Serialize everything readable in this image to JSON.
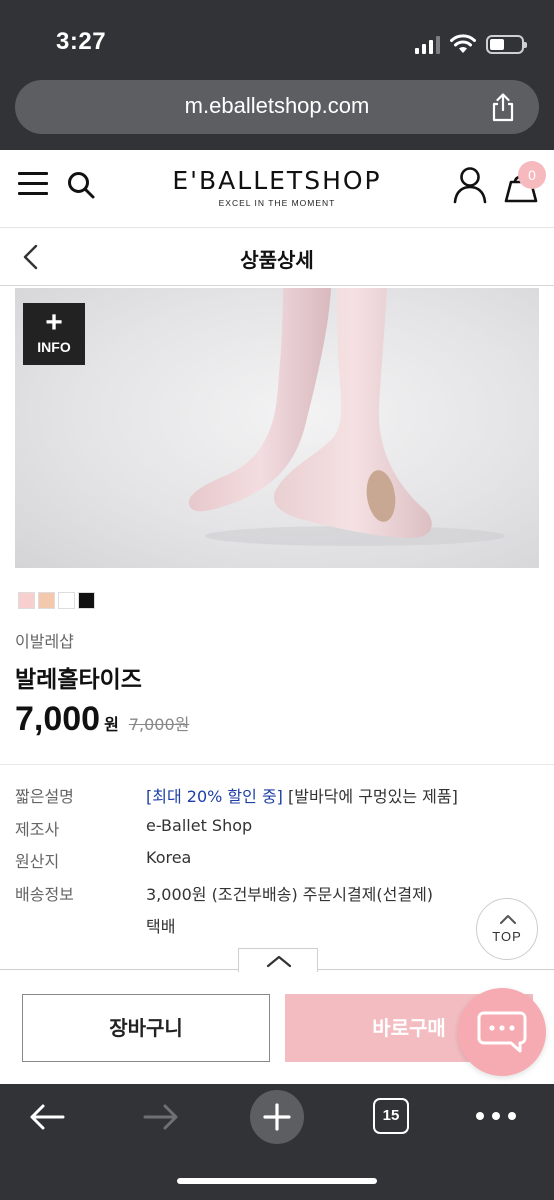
{
  "status_bar": {
    "time": "3:27"
  },
  "browser": {
    "url": "m.eballetshop.com",
    "tab_count": "15"
  },
  "site": {
    "logo": "E'BALLETSHOP",
    "tagline": "EXCEL IN THE MOMENT",
    "cart_count": "0"
  },
  "page": {
    "title": "상품상세"
  },
  "product": {
    "info_badge_plus": "+",
    "info_badge_text": "INFO",
    "swatch_colors": [
      "#f7cfcf",
      "#f4c8ad",
      "#ffffff",
      "#111111"
    ],
    "brand": "이발레샵",
    "name": "발레홀타이즈",
    "price": "7,000",
    "price_unit": "원",
    "original_price": "7,000원"
  },
  "details": {
    "rows": [
      {
        "label": "짧은설명",
        "highlight": "[최대 20% 할인 중]",
        "value": " [발바닥에 구멍있는 제품]"
      },
      {
        "label": "제조사",
        "value": "e-Ballet Shop"
      },
      {
        "label": "원산지",
        "value": "Korea"
      },
      {
        "label": "배송정보",
        "value": "3,000원 (조건부배송) 주문시결제(선결제)"
      },
      {
        "label": "",
        "value": "택배"
      }
    ]
  },
  "top_button": {
    "label": "TOP"
  },
  "actions": {
    "cart_label": "장바구니",
    "buy_label": "바로구매"
  },
  "colors": {
    "accent_pink": "#f2bcc0",
    "highlight_blue": "#1f3fa8",
    "chrome_dark": "#313336"
  }
}
